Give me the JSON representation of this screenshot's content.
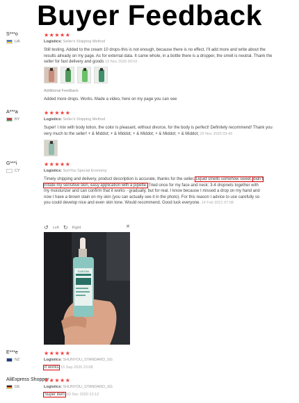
{
  "banner": {
    "title": "Buyer Feedback"
  },
  "colors": {
    "star": "#f23b3b",
    "highlight": "#d40000"
  },
  "reviews": [
    {
      "buyer": "S***o",
      "country": "UA",
      "stars": "★★★★★",
      "logistics_label": "Logistics:",
      "logistics": "Seller's Shipping Method",
      "text": "Still testing. Added to the cream 10 drops-this is not enough, because there is no effect. I'll add more and write about the results already on my page. As for external data. It came whole, in a bottle there is a dropper, the smell is neutral. Thank the seller for fast delivery and goods",
      "date": "19 Nov 2020 00:02",
      "additional_label": "Additional Feedback",
      "additional_text": "Added more drops. Works. Made a video, here on my page you can see"
    },
    {
      "buyer": "A***a",
      "country": "BY",
      "stars": "★★★★★",
      "logistics_label": "Logistics:",
      "logistics": "Seller's Shipping Method",
      "text": "Super! I mix with body lotion, the color is pleasant, without divorce, for the body is perfect! Definitely recommend! Thank you very much to the seller! + & Middot; + & Middot; + & Middot; + & Middot; + & Middot;",
      "date": "20 Nov 2020 03:43"
    },
    {
      "buyer": "G***i",
      "country": "CY",
      "stars": "★★★★★",
      "logistics_label": "Logistics:",
      "logistics": "SunYou Special Economy",
      "text_parts": {
        "p1": "Timely shipping and delivery, product description is accurate, thanks for the seller. ",
        "h1": "Liquid smells somehow sweet,",
        "h2": "didn't irritate my sensitive skin, easy application with a pipette.",
        "p2": " Tried once for my face and neck: 3-4 dropnets together with my moisturizer and can confirm that it works - gradually, but for real. I know because I missed a drop on my hand and now I have a brown stain on my skin (you can actually see it in the photo). For this reason I advice to use carefully so you could develop nice and even skin tone. Would recommend. Good luck everyone."
      },
      "date": "14 Feb 2021 07:08",
      "rotate_left": "Left",
      "rotate_right": "Right",
      "photo_label": "SUNTAN"
    },
    {
      "buyer": "E***e",
      "country": "NZ",
      "stars": "★★★★★",
      "logistics_label": "Logistics:",
      "logistics": "SHUNYOU_STANDARD_SG",
      "text": "it works",
      "date": "15 Sep 2020 23:08"
    },
    {
      "buyer": "AliExpress Shopper",
      "country": "DE",
      "stars": "★★★★★",
      "logistics_label": "Logistics:",
      "logistics": "SHUNYOU_STANDARD_SG",
      "text": "Super item",
      "date": "02 Dec 2020 12:12"
    }
  ]
}
